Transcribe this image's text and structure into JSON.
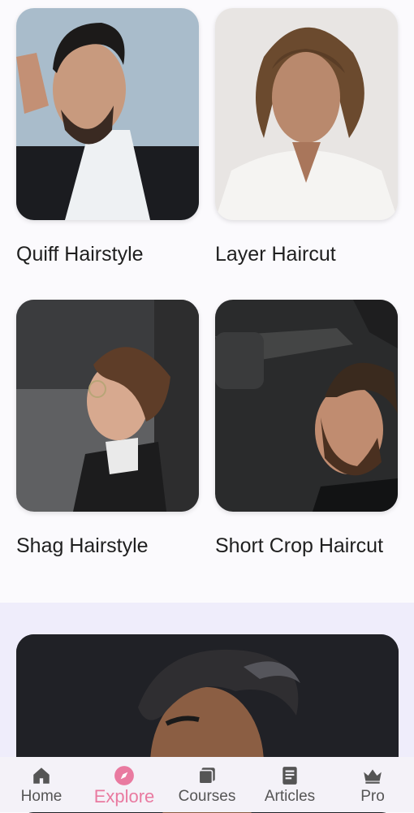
{
  "cards": [
    {
      "title": "Quiff Hairstyle"
    },
    {
      "title": "Layer Haircut"
    },
    {
      "title": "Shag Hairstyle"
    },
    {
      "title": "Short Crop Haircut"
    }
  ],
  "featured": {
    "image_alt": "man with undercut hairstyle"
  },
  "nav": {
    "items": [
      {
        "label": "Home",
        "icon": "home-icon"
      },
      {
        "label": "Explore",
        "icon": "compass-icon"
      },
      {
        "label": "Courses",
        "icon": "courses-icon"
      },
      {
        "label": "Articles",
        "icon": "articles-icon"
      },
      {
        "label": "Pro",
        "icon": "crown-icon"
      }
    ],
    "active_index": 1,
    "active_color": "#e97aa0"
  }
}
